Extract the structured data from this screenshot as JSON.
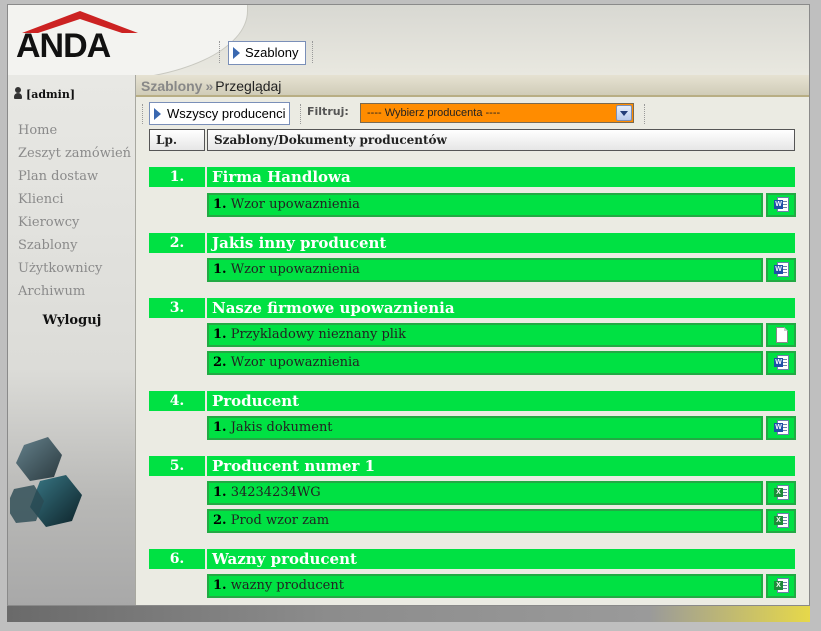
{
  "logo": {
    "text": "ANDA",
    "accent_color": "#cc2222"
  },
  "header": {
    "templates_button": "Szablony"
  },
  "sidebar": {
    "user": "[admin]",
    "nav": [
      "Home",
      "Zeszyt zamówień",
      "Plan dostaw",
      "Klienci",
      "Kierowcy",
      "Szablony",
      "Użytkownicy",
      "Archiwum"
    ],
    "logout": "Wyloguj"
  },
  "breadcrumb": {
    "section": "Szablony",
    "separator": "»",
    "page": "Przeglądaj"
  },
  "toolbar": {
    "all_producers_button": "Wszyscy producenci",
    "filter_label": "Filtruj:",
    "filter_value": "---- Wybierz producenta ----"
  },
  "table": {
    "col_number": "Lp.",
    "col_documents": "Szablony/Dokumenty producentów",
    "highlight_color": "#00e143",
    "groups": [
      {
        "num": "1.",
        "name": "Firma Handlowa",
        "items": [
          {
            "num": "1.",
            "name": "Wzor upowaznienia",
            "icon": "word-doc-icon"
          }
        ]
      },
      {
        "num": "2.",
        "name": "Jakis inny producent",
        "items": [
          {
            "num": "1.",
            "name": "Wzor upowaznienia",
            "icon": "word-doc-icon"
          }
        ]
      },
      {
        "num": "3.",
        "name": "Nasze firmowe upowaznienia",
        "items": [
          {
            "num": "1.",
            "name": "Przykladowy nieznany plik",
            "icon": "blank-file-icon"
          },
          {
            "num": "2.",
            "name": "Wzor upowaznienia",
            "icon": "word-doc-icon"
          }
        ]
      },
      {
        "num": "4.",
        "name": "Producent",
        "items": [
          {
            "num": "1.",
            "name": "Jakis dokument",
            "icon": "word-doc-icon"
          }
        ]
      },
      {
        "num": "5.",
        "name": "Producent numer 1",
        "items": [
          {
            "num": "1.",
            "name": "34234234WG",
            "icon": "excel-doc-icon"
          },
          {
            "num": "2.",
            "name": "Prod wzor zam",
            "icon": "excel-doc-icon"
          }
        ]
      },
      {
        "num": "6.",
        "name": "Wazny producent",
        "items": [
          {
            "num": "1.",
            "name": "wazny producent",
            "icon": "excel-doc-icon"
          }
        ]
      }
    ]
  }
}
